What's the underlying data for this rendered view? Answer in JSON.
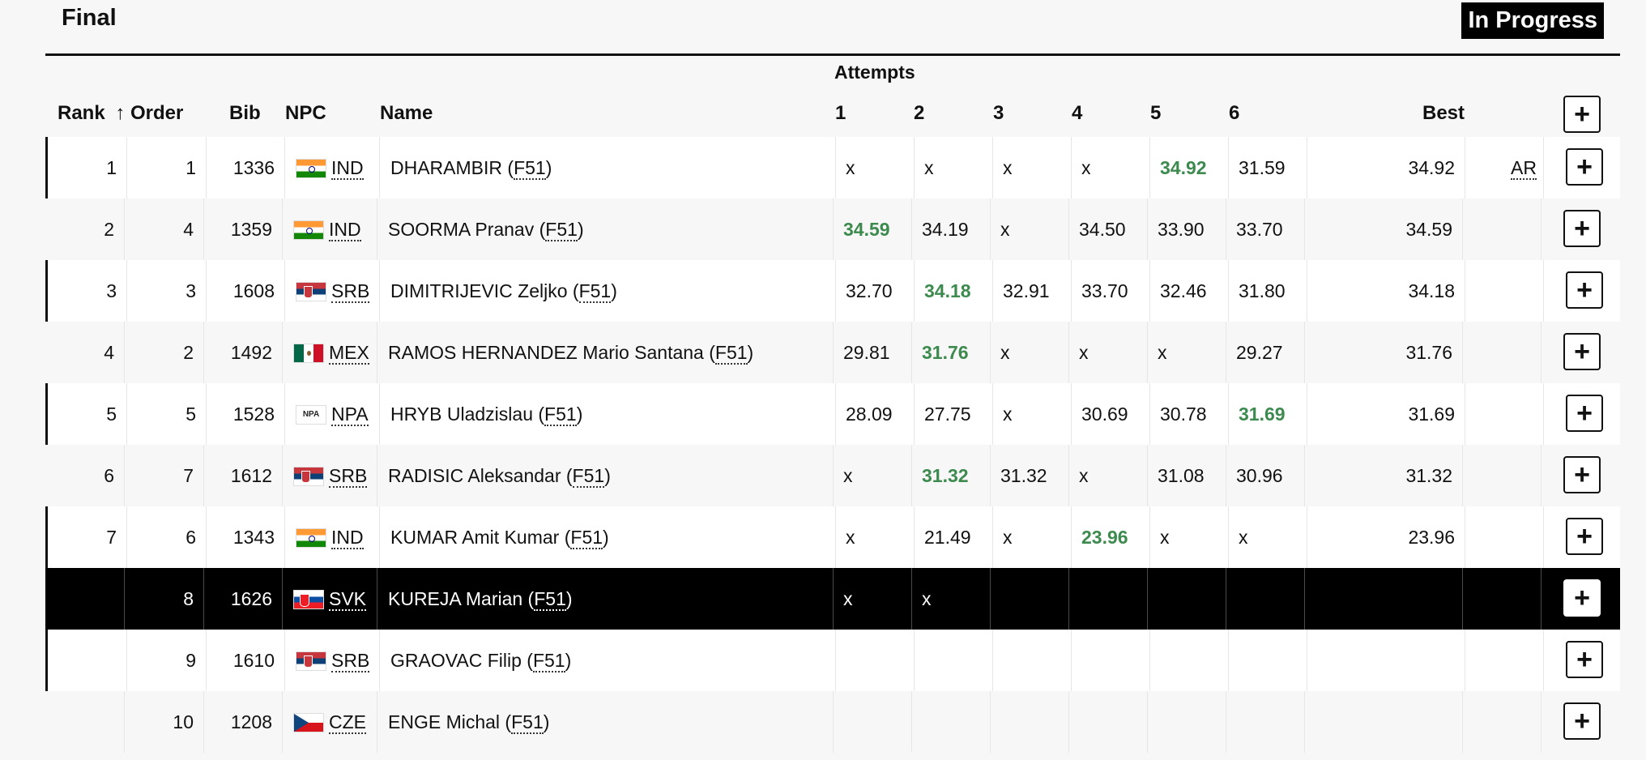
{
  "header": {
    "title": "Final",
    "status": "In Progress"
  },
  "table": {
    "attempts_title": "Attempts",
    "columns": {
      "rank": "Rank",
      "rank_sort_icon": "↑",
      "order": "Order",
      "bib": "Bib",
      "npc": "NPC",
      "name": "Name",
      "a1": "1",
      "a2": "2",
      "a3": "3",
      "a4": "4",
      "a5": "5",
      "a6": "6",
      "best": "Best"
    },
    "expand_icon": "+",
    "rows": [
      {
        "rank": "1",
        "order": "1",
        "bib": "1336",
        "flag": "ind",
        "npc": "IND",
        "name": "DHARAMBIR",
        "class": "F51",
        "attempts": [
          "x",
          "x",
          "x",
          "x",
          "34.92",
          "31.59"
        ],
        "best_index": 4,
        "best": "34.92",
        "record": "AR",
        "style": "white bar"
      },
      {
        "rank": "2",
        "order": "4",
        "bib": "1359",
        "flag": "ind",
        "npc": "IND",
        "name": "SOORMA Pranav",
        "class": "F51",
        "attempts": [
          "34.59",
          "34.19",
          "x",
          "34.50",
          "33.90",
          "33.70"
        ],
        "best_index": 0,
        "best": "34.59",
        "record": "",
        "style": "gray"
      },
      {
        "rank": "3",
        "order": "3",
        "bib": "1608",
        "flag": "srb",
        "npc": "SRB",
        "name": "DIMITRIJEVIC Zeljko",
        "class": "F51",
        "attempts": [
          "32.70",
          "34.18",
          "32.91",
          "33.70",
          "32.46",
          "31.80"
        ],
        "best_index": 1,
        "best": "34.18",
        "record": "",
        "style": "white bar"
      },
      {
        "rank": "4",
        "order": "2",
        "bib": "1492",
        "flag": "mex",
        "npc": "MEX",
        "name": "RAMOS HERNANDEZ Mario Santana",
        "class": "F51",
        "attempts": [
          "29.81",
          "31.76",
          "x",
          "x",
          "x",
          "29.27"
        ],
        "best_index": 1,
        "best": "31.76",
        "record": "",
        "style": "gray"
      },
      {
        "rank": "5",
        "order": "5",
        "bib": "1528",
        "flag": "npa",
        "flag_text": "NPA",
        "npc": "NPA",
        "name": "HRYB Uladzislau",
        "class": "F51",
        "attempts": [
          "28.09",
          "27.75",
          "x",
          "30.69",
          "30.78",
          "31.69"
        ],
        "best_index": 5,
        "best": "31.69",
        "record": "",
        "style": "white bar"
      },
      {
        "rank": "6",
        "order": "7",
        "bib": "1612",
        "flag": "srb",
        "npc": "SRB",
        "name": "RADISIC Aleksandar",
        "class": "F51",
        "attempts": [
          "x",
          "31.32",
          "31.32",
          "x",
          "31.08",
          "30.96"
        ],
        "best_index": 1,
        "best": "31.32",
        "record": "",
        "style": "gray"
      },
      {
        "rank": "7",
        "order": "6",
        "bib": "1343",
        "flag": "ind",
        "npc": "IND",
        "name": "KUMAR Amit Kumar",
        "class": "F51",
        "attempts": [
          "x",
          "21.49",
          "x",
          "23.96",
          "x",
          "x"
        ],
        "best_index": 3,
        "best": "23.96",
        "record": "",
        "style": "white bar"
      },
      {
        "rank": "",
        "order": "8",
        "bib": "1626",
        "flag": "svk",
        "npc": "SVK",
        "name": "KUREJA Marian",
        "class": "F51",
        "attempts": [
          "x",
          "x",
          "",
          "",
          "",
          ""
        ],
        "best_index": -1,
        "best": "",
        "record": "",
        "style": "active"
      },
      {
        "rank": "",
        "order": "9",
        "bib": "1610",
        "flag": "srb",
        "npc": "SRB",
        "name": "GRAOVAC Filip",
        "class": "F51",
        "attempts": [
          "",
          "",
          "",
          "",
          "",
          ""
        ],
        "best_index": -1,
        "best": "",
        "record": "",
        "style": "white bar"
      },
      {
        "rank": "",
        "order": "10",
        "bib": "1208",
        "flag": "cze",
        "npc": "CZE",
        "name": "ENGE Michal",
        "class": "F51",
        "attempts": [
          "",
          "",
          "",
          "",
          "",
          ""
        ],
        "best_index": -1,
        "best": "",
        "record": "",
        "style": "gray"
      }
    ]
  },
  "colors": {
    "best_attempt": "#3d8a4f",
    "active_row": "#000000"
  }
}
